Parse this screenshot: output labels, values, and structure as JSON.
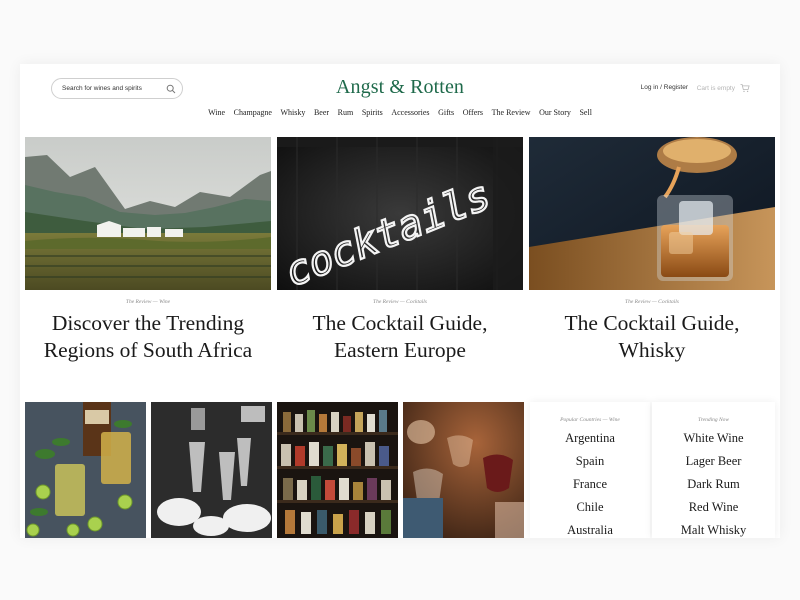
{
  "header": {
    "search_placeholder": "Search for wines and spirits",
    "logo": "Angst & Rotten",
    "account": "Log in / Register",
    "cart": "Cart is empty"
  },
  "nav": [
    "Wine",
    "Champagne",
    "Whisky",
    "Beer",
    "Rum",
    "Spirits",
    "Accessories",
    "Gifts",
    "Offers",
    "The Review",
    "Our Story",
    "Sell"
  ],
  "featured": [
    {
      "category": "The Review — Wine",
      "title_line1": "Discover the Trending",
      "title_line2": "Regions of South Africa"
    },
    {
      "category": "The Review — Cocktails",
      "title_line1": "The Cocktail Guide,",
      "title_line2": "Eastern Europe"
    },
    {
      "category": "The Review — Cocktails",
      "title_line1": "The Cocktail Guide,",
      "title_line2": "Whisky"
    }
  ],
  "popular_countries": {
    "caption": "Popular Countries — Wine",
    "items": [
      "Argentina",
      "Spain",
      "France",
      "Chile",
      "Australia"
    ]
  },
  "trending_now": {
    "caption": "Trending Now",
    "items": [
      "White Wine",
      "Lager Beer",
      "Dark Rum",
      "Red Wine",
      "Malt Whisky"
    ]
  },
  "neon_sign": "cocktails",
  "colors": {
    "brand": "#1f6a4b",
    "muted": "#8a8a8a"
  }
}
